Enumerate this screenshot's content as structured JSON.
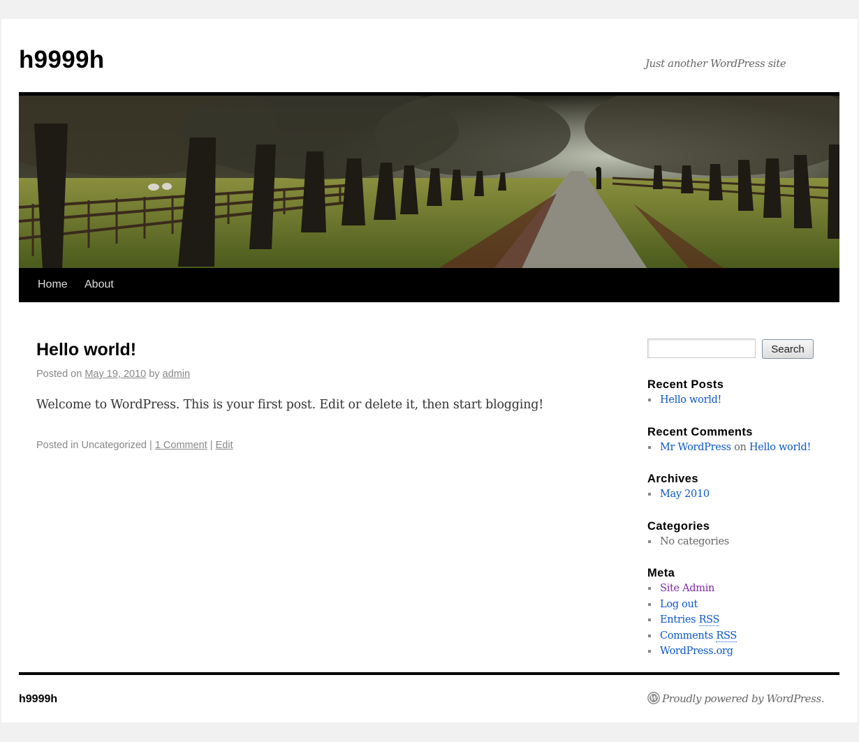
{
  "site": {
    "title": "h9999h",
    "description": "Just another WordPress site"
  },
  "nav": {
    "items": [
      {
        "label": "Home"
      },
      {
        "label": "About"
      }
    ]
  },
  "post": {
    "title": "Hello world!",
    "meta_prefix": "Posted on",
    "date": "May 19, 2010",
    "meta_by": "by",
    "author": "admin",
    "content": "Welcome to WordPress. This is your first post. Edit or delete it, then start blogging!",
    "footer_prefix": "Posted in Uncategorized |",
    "comments_link": "1 Comment",
    "separator": "|",
    "edit_link": "Edit"
  },
  "search": {
    "placeholder": "",
    "button_label": "Search"
  },
  "sidebar": {
    "recent_posts": {
      "title": "Recent Posts",
      "items": [
        "Hello world!"
      ]
    },
    "recent_comments": {
      "title": "Recent Comments",
      "author": "Mr WordPress",
      "connector": "on",
      "post": "Hello world!"
    },
    "archives": {
      "title": "Archives",
      "items": [
        "May 2010"
      ]
    },
    "categories": {
      "title": "Categories",
      "items": [
        "No categories"
      ]
    },
    "meta": {
      "title": "Meta",
      "site_admin": "Site Admin",
      "log_out": "Log out",
      "entries_prefix": "Entries",
      "comments_prefix": "Comments",
      "rss": "RSS",
      "wordpress_org": "WordPress.org"
    }
  },
  "footer": {
    "site_title": "h9999h",
    "generator": "Proudly powered by WordPress."
  },
  "colors": {
    "link": "#0b58c8",
    "visited_link": "#7e2aa8",
    "nav_bar": "#000000",
    "page_background": "#f1f1f1"
  },
  "icons": {
    "footer": "wordpress-logo-icon"
  }
}
